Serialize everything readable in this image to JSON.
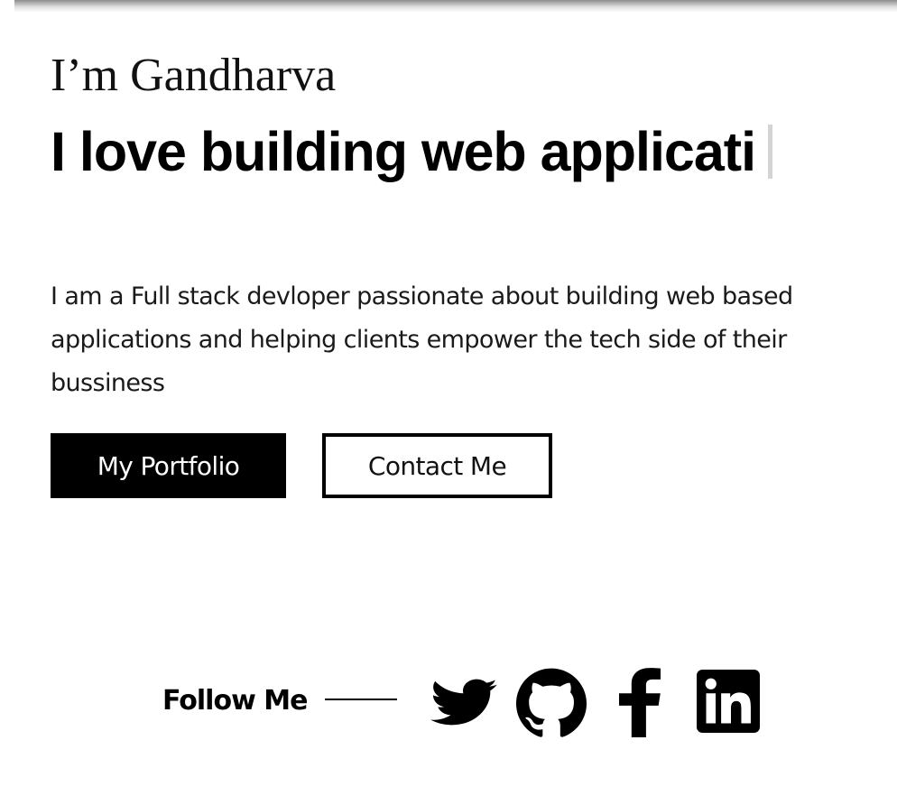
{
  "hero": {
    "intro": "I’m Gandharva",
    "tagline": "I love building web applicati",
    "description": "I am a Full stack devloper passionate about building web based applications and helping clients empower the tech side of their bussiness"
  },
  "buttons": {
    "primary_label": "My Portfolio",
    "secondary_label": "Contact Me"
  },
  "social": {
    "follow_label": "Follow Me",
    "icons": [
      "twitter-icon",
      "github-icon",
      "facebook-icon",
      "linkedin-icon"
    ],
    "icon_color": "#000000"
  },
  "colors": {
    "accent": "#000000",
    "background": "#ffffff",
    "cursor": "#d4d4d4"
  }
}
